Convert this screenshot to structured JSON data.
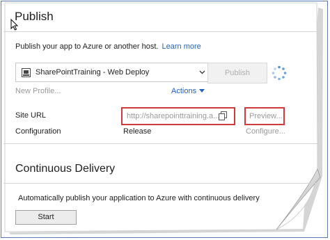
{
  "header": {
    "title": "Publish"
  },
  "intro": {
    "text": "Publish your app to Azure or another host.",
    "learn_more": "Learn more"
  },
  "profile": {
    "selected": "SharePointTraining - Web Deploy",
    "publish_label": "Publish",
    "new_profile": "New Profile...",
    "actions": "Actions"
  },
  "fields": {
    "site_url_label": "Site URL",
    "site_url_value": "http://sharepointtraining.a...",
    "preview_label": "Preview...",
    "configuration_label": "Configuration",
    "configuration_value": "Release",
    "configure_label": "Configure..."
  },
  "cd": {
    "title": "Continuous Delivery",
    "description": "Automatically publish your application to Azure with continuous delivery",
    "start_label": "Start"
  },
  "colors": {
    "accent": "#1e62c6",
    "highlight_border": "#d23a3a",
    "frame_border": "#5a78b4"
  },
  "icons": [
    "cursor-icon",
    "web-deploy-icon",
    "chevron-down-icon",
    "loading-spinner-icon",
    "caret-down-icon",
    "copy-icon"
  ]
}
